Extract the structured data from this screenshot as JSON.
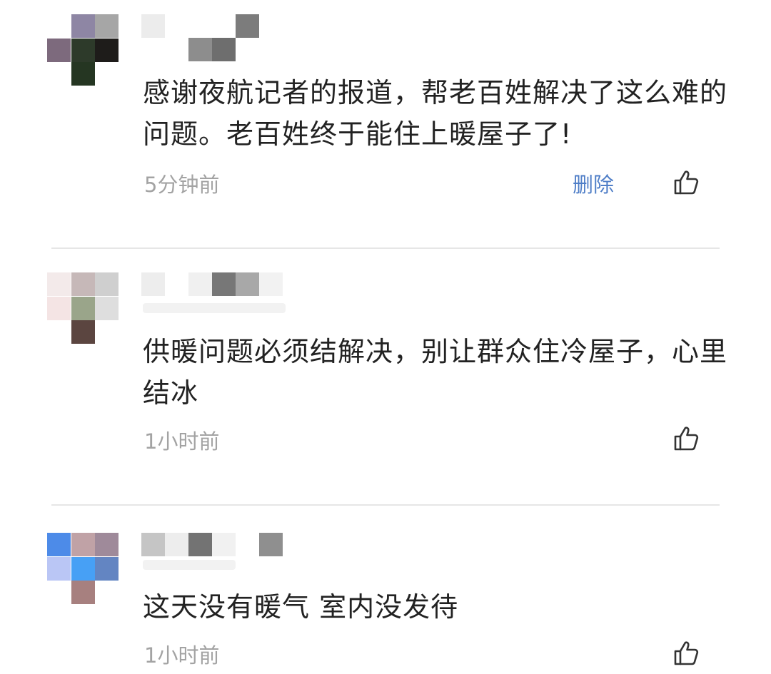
{
  "comments": [
    {
      "text": "感谢夜航记者的报道，帮老百姓解决了这么难的问题。老百姓终于能住上暖屋子了!",
      "time": "5分钟前",
      "delete_label": "删除",
      "like_icon": "thumbs-up-icon"
    },
    {
      "text": "供暖问题必须结解决，别让群众住冷屋子，心里结冰",
      "time": "1小时前",
      "like_icon": "thumbs-up-icon"
    },
    {
      "text": "这天没有暖气 室内没发待",
      "time": "1小时前",
      "like_icon": "thumbs-up-icon"
    }
  ],
  "colors": {
    "comment_text": "#222222",
    "timestamp": "#a3a3a3",
    "delete_link": "#4f7ec7",
    "divider": "#e6e6e6"
  }
}
